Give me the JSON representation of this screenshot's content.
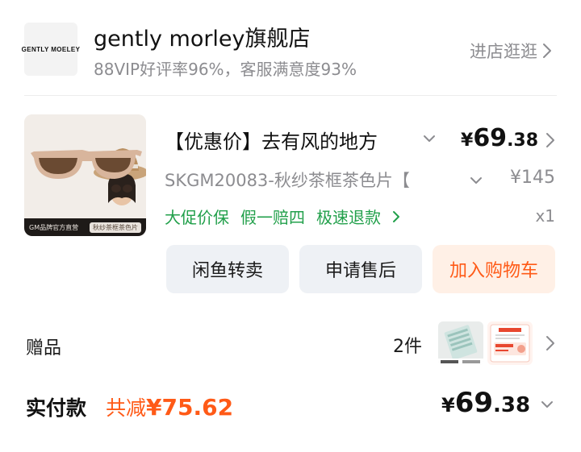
{
  "shop": {
    "logo_text": "GENTLY MOELEY",
    "name": "gently morley旗舰店",
    "stats": "88VIP好评率96%，客服满意度93%",
    "visit_label": "进店逛逛"
  },
  "product": {
    "title": "【优惠价】去有风的地方",
    "price_currency": "¥",
    "price_int": "69",
    "price_dec": ".38",
    "sku": "SKGM20083-秋纱茶框茶色片【",
    "original_price": "¥145",
    "badges": [
      "大促价保",
      "假一赔四",
      "极速退款"
    ],
    "quantity": "x1",
    "image_banner_left": "GM品牌官方直营",
    "image_banner_tag": "秋纱茶框茶色片"
  },
  "actions": {
    "resell": "闲鱼转卖",
    "after_sale": "申请售后",
    "add_cart": "加入购物车"
  },
  "gift": {
    "label": "赠品",
    "count": "2件"
  },
  "payment": {
    "label": "实付款",
    "discount_prefix": "共减",
    "discount_amount": "¥75.62",
    "total_currency": "¥",
    "total_int": "69",
    "total_dec": ".38"
  },
  "colors": {
    "accent_orange": "#ff5a17",
    "badge_green": "#22a04b",
    "muted_grey": "#8c8c90"
  }
}
